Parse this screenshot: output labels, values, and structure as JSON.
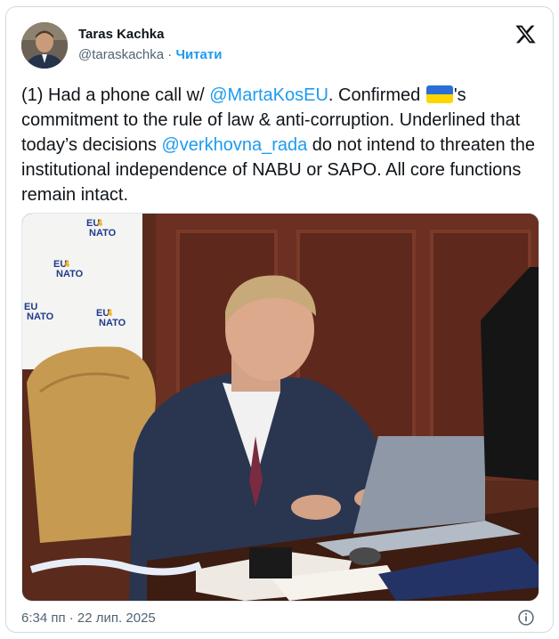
{
  "author": {
    "name": "Taras Kachka",
    "handle": "@taraskachka",
    "separator": "·",
    "follow_label": "Читати"
  },
  "tweet": {
    "text_part1": "(1) Had a phone call w/ ",
    "mention1": "@MartaKosEU",
    "text_part2": ". Confirmed ",
    "flag": "ukraine-flag-emoji",
    "text_part3": "'s commitment to the rule of law & anti-corruption. Underlined that today’s decisions ",
    "mention2": "@verkhovna_rada",
    "text_part4": " do not intend to threaten the institutional independence of NABU or SAPO. All core functions remain intact."
  },
  "photo": {
    "banner_logo_text": [
      "EU",
      "4",
      "NATO"
    ]
  },
  "footer": {
    "timestamp": "6:34 пп · 22 лип. 2025"
  },
  "colors": {
    "link": "#1d9bf0",
    "secondary_text": "#536471",
    "border": "#cfd9de",
    "flag_blue": "#2b6fd6",
    "flag_yellow": "#ffd500"
  },
  "icons": {
    "brand": "x-logo-icon",
    "info": "info-icon"
  }
}
